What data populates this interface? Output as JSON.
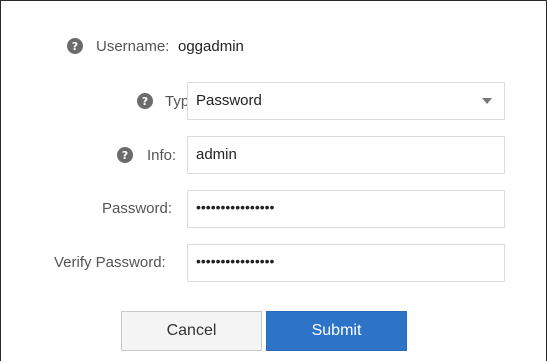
{
  "form": {
    "username": {
      "label": "Username:",
      "value": "oggadmin"
    },
    "type": {
      "label": "Type:",
      "value": "Password"
    },
    "info": {
      "label": "Info:",
      "value": "admin"
    },
    "password": {
      "label": "Password:",
      "masked_value": "••••••••••••••••"
    },
    "verify_password": {
      "label": "Verify Password:",
      "masked_value": "••••••••••••••••"
    }
  },
  "buttons": {
    "cancel_label": "Cancel",
    "submit_label": "Submit"
  },
  "icons": {
    "help": "question-circle-icon"
  },
  "colors": {
    "submit_bg": "#2d74c8",
    "cancel_bg": "#f4f4f4",
    "help_icon": "#6b6b6b"
  }
}
